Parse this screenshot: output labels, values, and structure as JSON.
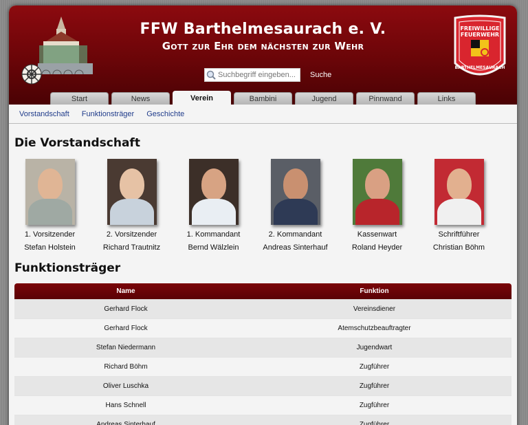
{
  "header": {
    "title": "FFW Barthelmesaurach e. V.",
    "subtitle": "Gott zur Ehr dem nächsten zur Wehr",
    "badge_text_top": "FREIWILLIGE FEUERWEHR",
    "badge_text_bottom": "BARTHELMESAURACH"
  },
  "search": {
    "placeholder": "Suchbegriff eingeben...",
    "button": "Suche"
  },
  "tabs": [
    {
      "label": "Start"
    },
    {
      "label": "News"
    },
    {
      "label": "Verein",
      "active": true
    },
    {
      "label": "Bambini"
    },
    {
      "label": "Jugend"
    },
    {
      "label": "Pinnwand"
    },
    {
      "label": "Links"
    }
  ],
  "subnav": [
    "Vorstandschaft",
    "Funktionsträger",
    "Geschichte"
  ],
  "vorstand": {
    "heading": "Die Vorstandschaft",
    "members": [
      {
        "role": "1. Vorsitzender",
        "name": "Stefan Holstein"
      },
      {
        "role": "2. Vorsitzender",
        "name": "Richard Trautnitz"
      },
      {
        "role": "1. Kommandant",
        "name": "Bernd Wälzlein"
      },
      {
        "role": "2. Kommandant",
        "name": "Andreas Sinterhauf"
      },
      {
        "role": "Kassenwart",
        "name": "Roland Heyder"
      },
      {
        "role": "Schriftführer",
        "name": "Christian Böhm"
      }
    ]
  },
  "funktion": {
    "heading": "Funktionsträger",
    "columns": [
      "Name",
      "Funktion"
    ],
    "rows": [
      [
        "Gerhard Flock",
        "Vereinsdiener"
      ],
      [
        "Gerhard Flock",
        "Atemschutzbeauftragter"
      ],
      [
        "Stefan Niedermann",
        "Jugendwart"
      ],
      [
        "Richard Böhm",
        "Zugführer"
      ],
      [
        "Oliver Luschka",
        "Zugführer"
      ],
      [
        "Hans Schnell",
        "Zugführer"
      ],
      [
        "Andreas Sinterhauf",
        "Zugführer"
      ]
    ]
  },
  "colors": {
    "brand_red": "#7a0509",
    "link_blue": "#1f3b8a"
  }
}
